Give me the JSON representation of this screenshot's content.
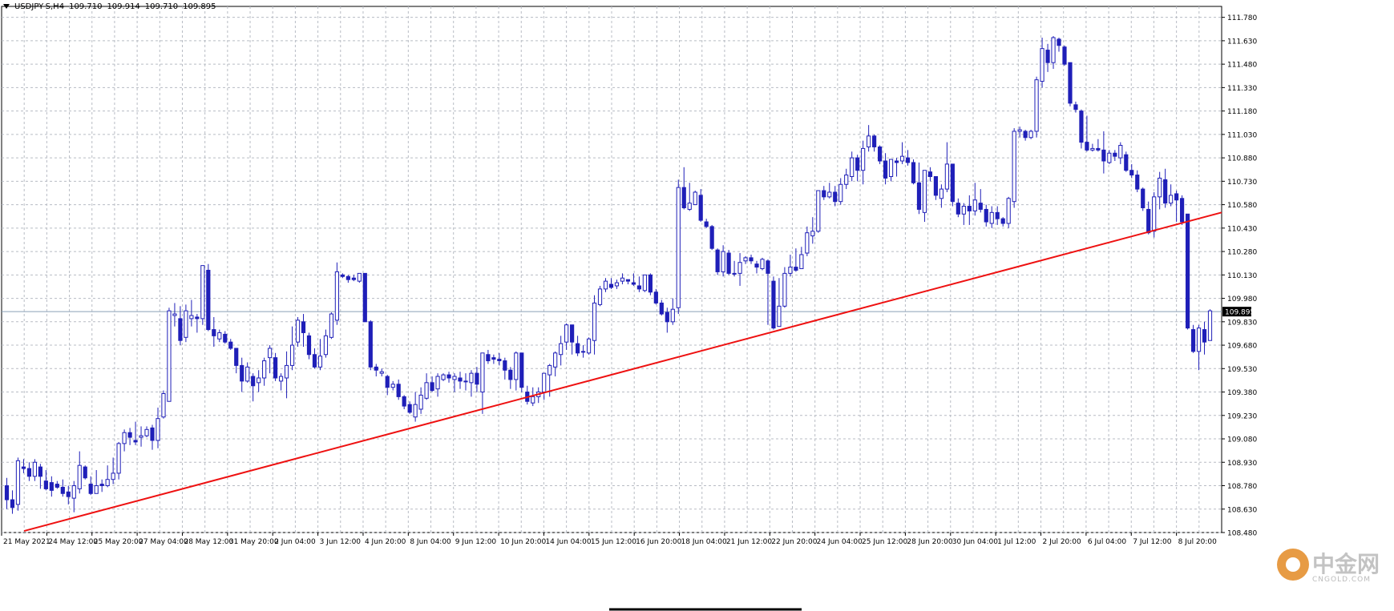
{
  "header": {
    "symbol": "USDJPY-S,H4",
    "open": "109.710",
    "high": "109.914",
    "low": "109.710",
    "close": "109.895"
  },
  "watermark": {
    "text": "中金网",
    "url": "CNGOLD.COM"
  },
  "colors": {
    "bull": "#1f1fb8",
    "bear": "#1f1fb8",
    "grid": "#b8bcc4",
    "trendline": "#ee1111",
    "priceline": "#8aa0b8"
  },
  "chart_data": {
    "type": "candlestick",
    "ylim": [
      108.48,
      111.85
    ],
    "y_ticks": [
      "111.780",
      "111.630",
      "111.480",
      "111.330",
      "111.180",
      "111.030",
      "110.880",
      "110.730",
      "110.580",
      "110.430",
      "110.280",
      "110.130",
      "109.980",
      "109.830",
      "109.680",
      "109.530",
      "109.380",
      "109.230",
      "109.080",
      "108.930",
      "108.780",
      "108.630",
      "108.480"
    ],
    "x_labels": [
      "21 May 2021",
      "24 May 12:00",
      "25 May 20:00",
      "27 May 04:00",
      "28 May 12:00",
      "31 May 20:00",
      "2 Jun 04:00",
      "3 Jun 12:00",
      "4 Jun 20:00",
      "8 Jun 04:00",
      "9 Jun 12:00",
      "10 Jun 20:00",
      "14 Jun 04:00",
      "15 Jun 12:00",
      "16 Jun 20:00",
      "18 Jun 04:00",
      "21 Jun 12:00",
      "22 Jun 20:00",
      "24 Jun 04:00",
      "25 Jun 12:00",
      "28 Jun 20:00",
      "30 Jun 04:00",
      "1 Jul 12:00",
      "2 Jul 20:00",
      "6 Jul 04:00",
      "7 Jul 12:00",
      "8 Jul 20:00"
    ],
    "last_price": 109.895,
    "trendline": {
      "start": 108.49,
      "end": 110.53
    },
    "candles": [
      [
        108.78,
        108.69,
        108.83,
        108.63
      ],
      [
        108.69,
        108.64,
        108.75,
        108.6
      ],
      [
        108.66,
        108.94,
        108.96,
        108.62
      ],
      [
        108.9,
        108.89,
        108.95,
        108.86
      ],
      [
        108.89,
        108.84,
        108.93,
        108.81
      ],
      [
        108.84,
        108.93,
        108.95,
        108.81
      ],
      [
        108.9,
        108.84,
        108.92,
        108.76
      ],
      [
        108.81,
        108.76,
        108.88,
        108.75
      ],
      [
        108.8,
        108.75,
        108.84,
        108.71
      ],
      [
        108.79,
        108.77,
        108.81,
        108.76
      ],
      [
        108.77,
        108.73,
        108.82,
        108.71
      ],
      [
        108.74,
        108.71,
        108.78,
        108.66
      ],
      [
        108.7,
        108.78,
        108.81,
        108.61
      ],
      [
        108.76,
        108.91,
        109.0,
        108.73
      ],
      [
        108.9,
        108.83,
        108.91,
        108.82
      ],
      [
        108.79,
        108.73,
        108.84,
        108.72
      ],
      [
        108.73,
        108.78,
        108.88,
        108.73
      ],
      [
        108.79,
        108.78,
        108.82,
        108.74
      ],
      [
        108.78,
        108.82,
        108.91,
        108.77
      ],
      [
        108.82,
        108.86,
        108.96,
        108.79
      ],
      [
        108.86,
        109.05,
        109.06,
        108.82
      ],
      [
        109.05,
        109.12,
        109.14,
        109.0
      ],
      [
        109.12,
        109.09,
        109.15,
        109.04
      ],
      [
        109.07,
        109.06,
        109.19,
        109.04
      ],
      [
        109.09,
        109.1,
        109.16,
        109.03
      ],
      [
        109.1,
        109.14,
        109.16,
        109.09
      ],
      [
        109.15,
        109.07,
        109.17,
        109.01
      ],
      [
        109.07,
        109.21,
        109.28,
        109.02
      ],
      [
        109.22,
        109.37,
        109.39,
        109.21
      ],
      [
        109.32,
        109.9,
        109.92,
        109.32
      ],
      [
        109.87,
        109.88,
        109.95,
        109.8
      ],
      [
        109.85,
        109.71,
        109.93,
        109.68
      ],
      [
        109.73,
        109.9,
        109.94,
        109.7
      ],
      [
        109.85,
        109.87,
        109.97,
        109.8
      ],
      [
        109.86,
        109.85,
        109.88,
        109.76
      ],
      [
        109.85,
        110.19,
        110.19,
        109.81
      ],
      [
        110.16,
        109.78,
        110.2,
        109.77
      ],
      [
        109.78,
        109.74,
        109.86,
        109.67
      ],
      [
        109.72,
        109.76,
        109.78,
        109.7
      ],
      [
        109.75,
        109.7,
        109.77,
        109.69
      ],
      [
        109.7,
        109.66,
        109.72,
        109.65
      ],
      [
        109.66,
        109.55,
        109.66,
        109.5
      ],
      [
        109.55,
        109.45,
        109.6,
        109.38
      ],
      [
        109.45,
        109.54,
        109.57,
        109.44
      ],
      [
        109.48,
        109.42,
        109.5,
        109.32
      ],
      [
        109.44,
        109.47,
        109.52,
        109.38
      ],
      [
        109.47,
        109.58,
        109.6,
        109.42
      ],
      [
        109.6,
        109.66,
        109.68,
        109.5
      ],
      [
        109.6,
        109.47,
        109.63,
        109.45
      ],
      [
        109.45,
        109.48,
        109.5,
        109.39
      ],
      [
        109.47,
        109.55,
        109.64,
        109.34
      ],
      [
        109.55,
        109.68,
        109.8,
        109.52
      ],
      [
        109.7,
        109.84,
        109.86,
        109.67
      ],
      [
        109.83,
        109.76,
        109.88,
        109.67
      ],
      [
        109.74,
        109.62,
        109.76,
        109.59
      ],
      [
        109.62,
        109.54,
        109.66,
        109.53
      ],
      [
        109.54,
        109.61,
        109.72,
        109.52
      ],
      [
        109.62,
        109.74,
        109.78,
        109.6
      ],
      [
        109.73,
        109.88,
        109.89,
        109.72
      ],
      [
        109.84,
        110.15,
        110.21,
        109.81
      ],
      [
        110.13,
        110.12,
        110.14,
        110.11
      ],
      [
        110.12,
        110.1,
        110.13,
        110.08
      ],
      [
        110.11,
        110.1,
        110.13,
        110.09
      ],
      [
        110.09,
        110.14,
        110.14,
        110.08
      ],
      [
        110.14,
        109.83,
        110.14,
        109.83
      ],
      [
        109.83,
        109.54,
        109.84,
        109.52
      ],
      [
        109.54,
        109.52,
        109.56,
        109.48
      ],
      [
        109.5,
        109.51,
        109.53,
        109.48
      ],
      [
        109.48,
        109.41,
        109.49,
        109.36
      ],
      [
        109.41,
        109.43,
        109.45,
        109.39
      ],
      [
        109.43,
        109.35,
        109.46,
        109.33
      ],
      [
        109.35,
        109.29,
        109.36,
        109.27
      ],
      [
        109.3,
        109.25,
        109.32,
        109.24
      ],
      [
        109.22,
        109.3,
        109.38,
        109.19
      ],
      [
        109.27,
        109.36,
        109.41,
        109.24
      ],
      [
        109.34,
        109.44,
        109.5,
        109.33
      ],
      [
        109.44,
        109.39,
        109.48,
        109.38
      ],
      [
        109.4,
        109.48,
        109.5,
        109.35
      ],
      [
        109.46,
        109.49,
        109.5,
        109.45
      ],
      [
        109.49,
        109.47,
        109.51,
        109.44
      ],
      [
        109.46,
        109.48,
        109.5,
        109.38
      ],
      [
        109.47,
        109.45,
        109.51,
        109.4
      ],
      [
        109.45,
        109.45,
        109.5,
        109.39
      ],
      [
        109.44,
        109.5,
        109.52,
        109.35
      ],
      [
        109.5,
        109.43,
        109.54,
        109.38
      ],
      [
        109.38,
        109.63,
        109.63,
        109.24
      ],
      [
        109.62,
        109.58,
        109.65,
        109.56
      ],
      [
        109.6,
        109.59,
        109.62,
        109.56
      ],
      [
        109.59,
        109.58,
        109.63,
        109.55
      ],
      [
        109.58,
        109.52,
        109.6,
        109.46
      ],
      [
        109.52,
        109.46,
        109.54,
        109.4
      ],
      [
        109.46,
        109.63,
        109.64,
        109.39
      ],
      [
        109.63,
        109.41,
        109.63,
        109.38
      ],
      [
        109.38,
        109.32,
        109.42,
        109.3
      ],
      [
        109.31,
        109.35,
        109.41,
        109.29
      ],
      [
        109.35,
        109.38,
        109.41,
        109.31
      ],
      [
        109.38,
        109.5,
        109.5,
        109.33
      ],
      [
        109.49,
        109.55,
        109.56,
        109.35
      ],
      [
        109.54,
        109.63,
        109.64,
        109.48
      ],
      [
        109.62,
        109.69,
        109.74,
        109.55
      ],
      [
        109.7,
        109.81,
        109.82,
        109.65
      ],
      [
        109.81,
        109.7,
        109.81,
        109.62
      ],
      [
        109.69,
        109.63,
        109.74,
        109.61
      ],
      [
        109.64,
        109.64,
        109.68,
        109.6
      ],
      [
        109.63,
        109.72,
        109.73,
        109.62
      ],
      [
        109.71,
        109.95,
        110.0,
        109.62
      ],
      [
        109.94,
        110.04,
        110.06,
        109.93
      ],
      [
        110.04,
        110.09,
        110.11,
        110.02
      ],
      [
        110.07,
        110.05,
        110.11,
        110.04
      ],
      [
        110.06,
        110.08,
        110.1,
        110.04
      ],
      [
        110.09,
        110.11,
        110.14,
        110.07
      ],
      [
        110.1,
        110.09,
        110.1,
        110.07
      ],
      [
        110.08,
        110.07,
        110.14,
        110.06
      ],
      [
        110.06,
        110.04,
        110.12,
        110.02
      ],
      [
        110.03,
        110.13,
        110.13,
        110.02
      ],
      [
        110.13,
        110.02,
        110.14,
        110.0
      ],
      [
        110.02,
        109.95,
        110.04,
        109.94
      ],
      [
        109.95,
        109.88,
        109.97,
        109.87
      ],
      [
        109.89,
        109.83,
        109.92,
        109.76
      ],
      [
        109.83,
        109.91,
        109.98,
        109.81
      ],
      [
        109.92,
        110.69,
        110.74,
        109.88
      ],
      [
        110.69,
        110.56,
        110.82,
        110.55
      ],
      [
        110.55,
        110.59,
        110.72,
        110.54
      ],
      [
        110.58,
        110.66,
        110.67,
        110.6
      ],
      [
        110.64,
        110.48,
        110.68,
        110.47
      ],
      [
        110.47,
        110.44,
        110.49,
        110.43
      ],
      [
        110.44,
        110.3,
        110.45,
        110.29
      ],
      [
        110.29,
        110.15,
        110.3,
        110.13
      ],
      [
        110.15,
        110.28,
        110.32,
        110.12
      ],
      [
        110.27,
        110.14,
        110.29,
        110.13
      ],
      [
        110.14,
        110.14,
        110.22,
        110.12
      ],
      [
        110.14,
        110.21,
        110.27,
        110.06
      ],
      [
        110.22,
        110.24,
        110.25,
        110.2
      ],
      [
        110.24,
        110.22,
        110.26,
        110.2
      ],
      [
        110.2,
        110.18,
        110.22,
        110.14
      ],
      [
        110.17,
        110.23,
        110.24,
        110.16
      ],
      [
        110.22,
        110.14,
        110.23,
        109.81
      ],
      [
        110.09,
        109.79,
        110.12,
        109.78
      ],
      [
        109.8,
        109.93,
        110.11,
        109.8
      ],
      [
        109.93,
        110.14,
        110.18,
        109.92
      ],
      [
        110.14,
        110.18,
        110.26,
        110.12
      ],
      [
        110.18,
        110.16,
        110.3,
        110.15
      ],
      [
        110.17,
        110.26,
        110.31,
        110.22
      ],
      [
        110.27,
        110.4,
        110.44,
        110.25
      ],
      [
        110.38,
        110.41,
        110.5,
        110.33
      ],
      [
        110.41,
        110.67,
        110.67,
        110.4
      ],
      [
        110.67,
        110.63,
        110.7,
        110.61
      ],
      [
        110.63,
        110.66,
        110.72,
        110.62
      ],
      [
        110.66,
        110.6,
        110.7,
        110.57
      ],
      [
        110.6,
        110.71,
        110.75,
        110.58
      ],
      [
        110.71,
        110.77,
        110.81,
        110.68
      ],
      [
        110.76,
        110.88,
        110.92,
        110.73
      ],
      [
        110.88,
        110.8,
        110.9,
        110.73
      ],
      [
        110.8,
        110.94,
        110.99,
        110.71
      ],
      [
        110.95,
        111.02,
        111.09,
        110.92
      ],
      [
        111.02,
        110.95,
        111.03,
        110.92
      ],
      [
        110.95,
        110.86,
        110.96,
        110.84
      ],
      [
        110.86,
        110.75,
        110.91,
        110.71
      ],
      [
        110.76,
        110.87,
        110.87,
        110.73
      ],
      [
        110.86,
        110.85,
        110.88,
        110.76
      ],
      [
        110.86,
        110.89,
        110.98,
        110.84
      ],
      [
        110.88,
        110.85,
        110.93,
        110.83
      ],
      [
        110.85,
        110.72,
        110.87,
        110.71
      ],
      [
        110.72,
        110.55,
        110.85,
        110.52
      ],
      [
        110.53,
        110.8,
        110.8,
        110.47
      ],
      [
        110.79,
        110.76,
        110.82,
        110.73
      ],
      [
        110.76,
        110.64,
        110.76,
        110.61
      ],
      [
        110.62,
        110.68,
        110.71,
        110.56
      ],
      [
        110.68,
        110.84,
        110.98,
        110.66
      ],
      [
        110.84,
        110.6,
        110.84,
        110.57
      ],
      [
        110.59,
        110.52,
        110.62,
        110.5
      ],
      [
        110.52,
        110.57,
        110.59,
        110.45
      ],
      [
        110.57,
        110.54,
        110.64,
        110.45
      ],
      [
        110.54,
        110.61,
        110.72,
        110.51
      ],
      [
        110.59,
        110.55,
        110.68,
        110.53
      ],
      [
        110.55,
        110.47,
        110.58,
        110.44
      ],
      [
        110.46,
        110.53,
        110.57,
        110.43
      ],
      [
        110.53,
        110.49,
        110.57,
        110.45
      ],
      [
        110.49,
        110.46,
        110.5,
        110.44
      ],
      [
        110.46,
        110.62,
        110.63,
        110.43
      ],
      [
        110.6,
        111.05,
        111.07,
        110.56
      ],
      [
        111.05,
        111.06,
        111.08,
        111.01
      ],
      [
        111.05,
        111.01,
        111.06,
        110.99
      ],
      [
        111.01,
        111.05,
        111.06,
        111.0
      ],
      [
        111.05,
        111.38,
        111.4,
        111.01
      ],
      [
        111.37,
        111.58,
        111.65,
        111.33
      ],
      [
        111.57,
        111.49,
        111.61,
        111.43
      ],
      [
        111.49,
        111.65,
        111.66,
        111.45
      ],
      [
        111.64,
        111.6,
        111.65,
        111.56
      ],
      [
        111.59,
        111.48,
        111.6,
        111.47
      ],
      [
        111.49,
        111.23,
        111.49,
        111.21
      ],
      [
        111.22,
        111.19,
        111.24,
        111.17
      ],
      [
        111.18,
        110.98,
        111.19,
        110.94
      ],
      [
        110.98,
        110.93,
        111.15,
        110.92
      ],
      [
        110.93,
        110.94,
        110.97,
        110.92
      ],
      [
        110.94,
        110.93,
        111.0,
        110.92
      ],
      [
        110.93,
        110.86,
        111.05,
        110.78
      ],
      [
        110.85,
        110.91,
        110.93,
        110.84
      ],
      [
        110.91,
        110.89,
        110.93,
        110.86
      ],
      [
        110.88,
        110.96,
        110.98,
        110.84
      ],
      [
        110.9,
        110.8,
        110.92,
        110.79
      ],
      [
        110.8,
        110.77,
        110.84,
        110.75
      ],
      [
        110.77,
        110.68,
        110.8,
        110.66
      ],
      [
        110.68,
        110.56,
        110.69,
        110.54
      ],
      [
        110.55,
        110.4,
        110.6,
        110.39
      ],
      [
        110.41,
        110.63,
        110.66,
        110.37
      ],
      [
        110.63,
        110.75,
        110.79,
        110.55
      ],
      [
        110.74,
        110.59,
        110.81,
        110.56
      ],
      [
        110.59,
        110.64,
        110.71,
        110.57
      ],
      [
        110.65,
        110.61,
        110.67,
        110.47
      ],
      [
        110.62,
        110.47,
        110.64,
        110.45
      ],
      [
        110.52,
        109.79,
        110.52,
        109.78
      ],
      [
        109.78,
        109.64,
        109.81,
        109.63
      ],
      [
        109.64,
        109.79,
        109.81,
        109.52
      ],
      [
        109.78,
        109.7,
        109.83,
        109.62
      ],
      [
        109.71,
        109.9,
        109.91,
        109.71
      ]
    ]
  }
}
